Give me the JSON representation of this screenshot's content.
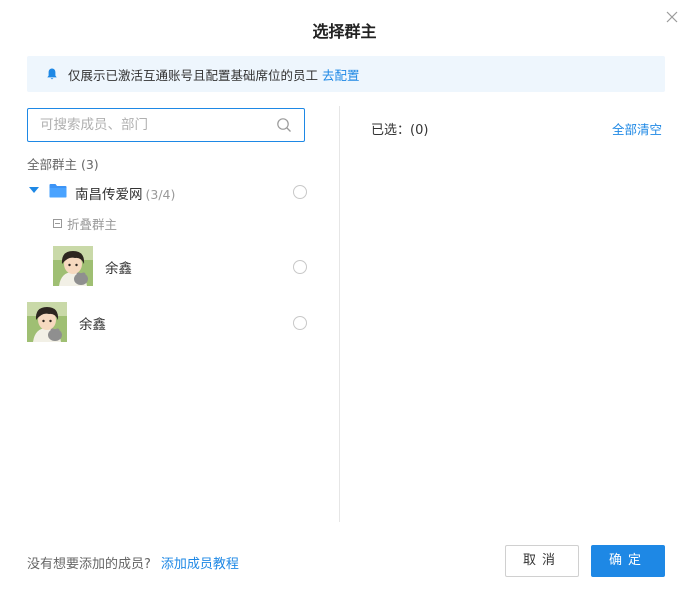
{
  "dialog": {
    "title": "选择群主",
    "close_icon": "close-icon"
  },
  "notice": {
    "icon": "bell-icon",
    "text": "仅展示已激活互通账号且配置基础席位的员工",
    "link": "去配置"
  },
  "search": {
    "placeholder": "可搜索成员、部门",
    "value": "",
    "icon": "search-icon"
  },
  "left": {
    "group_label": "全部群主 (3)",
    "department": {
      "name": "南昌传爱网",
      "count": "(3/4)",
      "icon": "folder-icon"
    },
    "collapse_label": "折叠群主",
    "members": [
      {
        "name": "余鑫"
      },
      {
        "name": "余鑫"
      }
    ]
  },
  "right": {
    "selected_label": "已选：(0)",
    "clear_all": "全部清空"
  },
  "footer": {
    "prompt": "没有想要添加的成员?",
    "link": "添加成员教程",
    "cancel": "取消",
    "ok": "确定"
  },
  "colors": {
    "accent": "#1e88e5",
    "notice_bg": "#eef6fd"
  }
}
